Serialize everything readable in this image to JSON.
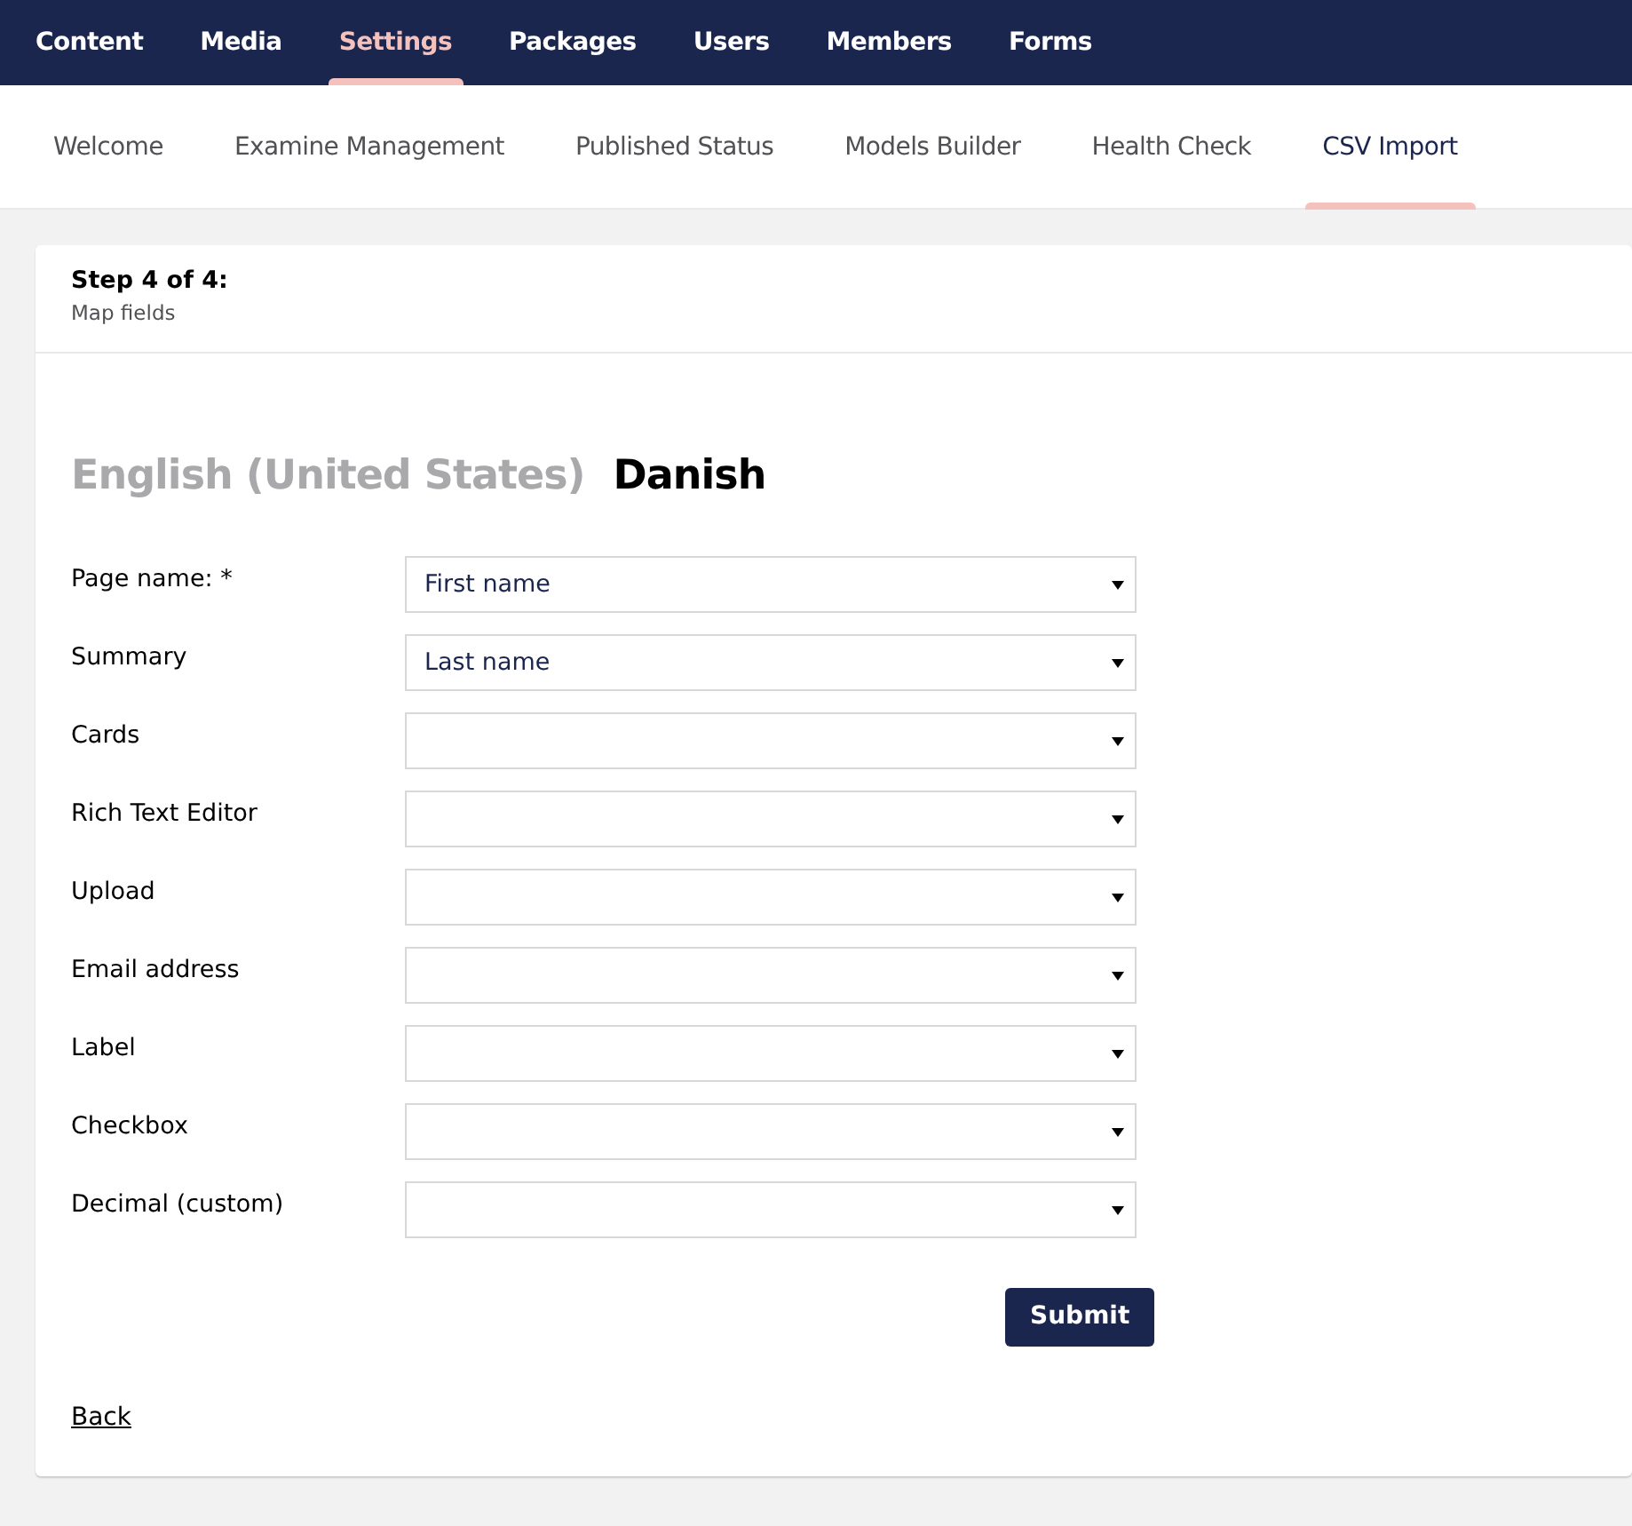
{
  "main_nav": [
    {
      "label": "Content",
      "selected": false
    },
    {
      "label": "Media",
      "selected": false
    },
    {
      "label": "Settings",
      "selected": true
    },
    {
      "label": "Packages",
      "selected": false
    },
    {
      "label": "Users",
      "selected": false
    },
    {
      "label": "Members",
      "selected": false
    },
    {
      "label": "Forms",
      "selected": false
    }
  ],
  "sub_nav": [
    {
      "label": "Welcome",
      "selected": false
    },
    {
      "label": "Examine Management",
      "selected": false
    },
    {
      "label": "Published Status",
      "selected": false
    },
    {
      "label": "Models Builder",
      "selected": false
    },
    {
      "label": "Health Check",
      "selected": false
    },
    {
      "label": "CSV Import",
      "selected": true
    }
  ],
  "step": {
    "title": "Step 4 of 4:",
    "subtitle": "Map fields"
  },
  "languages": [
    {
      "label": "English (United States)",
      "selected": false
    },
    {
      "label": "Danish",
      "selected": true
    }
  ],
  "fields": [
    {
      "label": "Page name: *",
      "value": "First name"
    },
    {
      "label": "Summary",
      "value": "Last name"
    },
    {
      "label": "Cards"
    },
    {
      "label": "Rich Text Editor"
    },
    {
      "label": "Upload"
    },
    {
      "label": "Email address"
    },
    {
      "label": "Label"
    },
    {
      "label": "Checkbox"
    },
    {
      "label": "Decimal (custom)"
    }
  ],
  "submit": "Submit",
  "back": "Back"
}
